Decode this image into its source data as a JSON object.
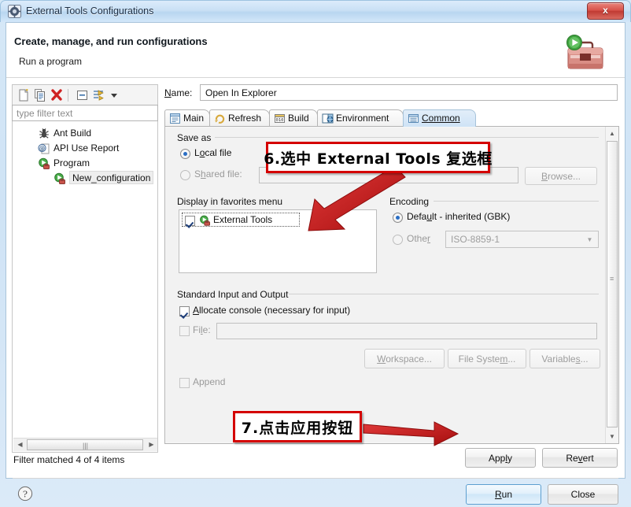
{
  "window": {
    "title": "External Tools Configurations",
    "icon": "external-tools-icon",
    "close_label": "x"
  },
  "header": {
    "title": "Create, manage, and run configurations",
    "subtitle": "Run a program",
    "art_icon": "toolbox-run-icon"
  },
  "left_panel": {
    "toolbar": [
      {
        "name": "new-configuration-icon",
        "tooltip": "New"
      },
      {
        "name": "duplicate-configuration-icon",
        "tooltip": "Duplicate"
      },
      {
        "name": "delete-configuration-icon",
        "tooltip": "Delete"
      },
      {
        "name": "collapse-all-icon",
        "tooltip": "Collapse All"
      },
      {
        "name": "filter-icon",
        "tooltip": "Filter"
      },
      {
        "name": "chevron-down-icon",
        "tooltip": "Menu"
      }
    ],
    "filter_placeholder": "type filter text",
    "tree": [
      {
        "label": "Ant Build",
        "icon": "ant-build-icon",
        "indent": 0,
        "selected": false
      },
      {
        "label": "API Use Report",
        "icon": "api-use-report-icon",
        "indent": 0,
        "selected": false
      },
      {
        "label": "Program",
        "icon": "program-icon",
        "indent": 0,
        "selected": false
      },
      {
        "label": "New_configuration",
        "icon": "program-icon",
        "indent": 1,
        "selected": true
      }
    ],
    "status": "Filter matched 4 of 4 items"
  },
  "right_panel": {
    "name_label": "Name:",
    "name_value": "Open In Explorer",
    "tabs": [
      {
        "label": "Main",
        "icon": "main-tab-icon",
        "active": false
      },
      {
        "label": "Refresh",
        "icon": "refresh-tab-icon",
        "active": false
      },
      {
        "label": "Build",
        "icon": "build-tab-icon",
        "active": false
      },
      {
        "label": "Environment",
        "icon": "environment-tab-icon",
        "active": false
      },
      {
        "label": "Common",
        "icon": "common-tab-icon",
        "active": true
      }
    ],
    "save_as": {
      "group_label": "Save as",
      "local_file_label": "Local file",
      "local_file_checked": true,
      "shared_file_label": "Shared file:",
      "shared_file_checked": false,
      "shared_file_value": "",
      "browse_label": "Browse..."
    },
    "favorites": {
      "group_label": "Display in favorites menu",
      "items": [
        {
          "label": "External Tools",
          "icon": "external-tools-small-icon",
          "checked": true
        }
      ]
    },
    "encoding": {
      "group_label": "Encoding",
      "default_label": "Default - inherited (GBK)",
      "default_checked": true,
      "other_label": "Other",
      "other_checked": false,
      "other_value": "ISO-8859-1"
    },
    "std_io": {
      "group_label": "Standard Input and Output",
      "allocate_console_label": "Allocate console (necessary for input)",
      "allocate_console_checked": true,
      "file_label": "File:",
      "file_checked": false,
      "file_value": "",
      "workspace_label": "Workspace...",
      "file_system_label": "File System...",
      "variables_label": "Variables...",
      "append_label": "Append",
      "append_checked": false
    },
    "apply_label": "Apply",
    "revert_label": "Revert"
  },
  "footer": {
    "help_icon": "help-icon",
    "run_label": "Run",
    "close_label": "Close"
  },
  "annotations": [
    {
      "id": "step6",
      "text": "6.选中 External Tools 复选框"
    },
    {
      "id": "step7",
      "text": "7.点击应用按钮"
    }
  ],
  "colors": {
    "annotation_border": "#d40000",
    "arrow": "#c00000",
    "accent": "#2a6ec4",
    "title_gradient_top": "#dcecfb"
  }
}
